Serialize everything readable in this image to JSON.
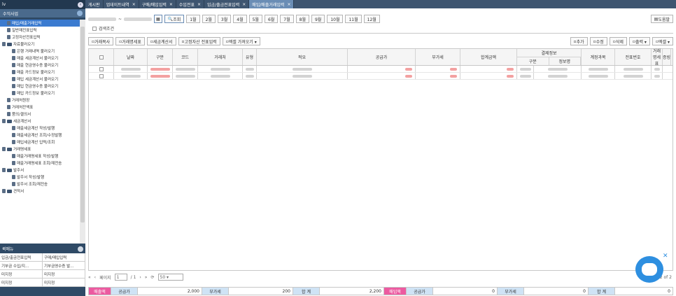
{
  "left_panel": {
    "title": "lv",
    "section": "수익사업",
    "tree": [
      {
        "label": "매입/매출거래입력",
        "level": 1,
        "type": "doc",
        "selected": true
      },
      {
        "label": "일반매전표입력",
        "level": 1,
        "type": "doc"
      },
      {
        "label": "고정자산전표입력",
        "level": 1,
        "type": "doc"
      },
      {
        "label": "자료불러오기",
        "level": 0,
        "type": "folder"
      },
      {
        "label": "은행 거래내역 불러오기",
        "level": 2,
        "type": "doc"
      },
      {
        "label": "매출 세금계산서 불러오기",
        "level": 2,
        "type": "doc"
      },
      {
        "label": "매출 현금영수증 불러오기",
        "level": 2,
        "type": "doc"
      },
      {
        "label": "매출 카드정보 불러오기",
        "level": 2,
        "type": "doc"
      },
      {
        "label": "매입 세금계산서 불러오기",
        "level": 2,
        "type": "doc"
      },
      {
        "label": "매입 현금영수증 불러오기",
        "level": 2,
        "type": "doc"
      },
      {
        "label": "매입 카드정보 불러오기",
        "level": 2,
        "type": "doc"
      },
      {
        "label": "거래처원장",
        "level": 1,
        "type": "doc"
      },
      {
        "label": "거래처잔액표",
        "level": 1,
        "type": "doc"
      },
      {
        "label": "품의/결의서",
        "level": 1,
        "type": "doc"
      },
      {
        "label": "세금계산서",
        "level": 0,
        "type": "folder"
      },
      {
        "label": "매출세금계산 작성/발행",
        "level": 2,
        "type": "doc"
      },
      {
        "label": "매출세금계산 조회/수정발행",
        "level": 2,
        "type": "doc"
      },
      {
        "label": "매입세금계산 입력/조회",
        "level": 2,
        "type": "doc"
      },
      {
        "label": "거래명세표",
        "level": 0,
        "type": "folder"
      },
      {
        "label": "매출거래명세표 작성/발행",
        "level": 2,
        "type": "doc"
      },
      {
        "label": "매출거래명세표 조회/재전송",
        "level": 2,
        "type": "doc"
      },
      {
        "label": "발주서",
        "level": 0,
        "type": "folder"
      },
      {
        "label": "발주서 작성/발행",
        "level": 2,
        "type": "doc"
      },
      {
        "label": "발주서 조회/재전송",
        "level": 2,
        "type": "doc"
      },
      {
        "label": "견적서",
        "level": 0,
        "type": "folder"
      }
    ],
    "quick_menu": {
      "title": "퀵메뉴",
      "rows": [
        [
          "입금/출금전표입력",
          "구매/매입입력"
        ],
        [
          "기부금 수입/지…",
          "기부금영수증 발…"
        ],
        [
          "미지정",
          "미지정"
        ],
        [
          "미지정",
          "미지정"
        ]
      ]
    }
  },
  "tabs": [
    {
      "label": "게시판",
      "active": false
    },
    {
      "label": "업데이트내역",
      "active": false
    },
    {
      "label": "구매/매입입력",
      "active": false
    },
    {
      "label": "수입전표",
      "active": false
    },
    {
      "label": "입금/출금전표입력",
      "active": false
    },
    {
      "label": "매입/매출거래입력",
      "active": true
    }
  ],
  "toolbar": {
    "tilde": "~",
    "search_label": "조회",
    "months": [
      "1월",
      "2월",
      "3월",
      "4월",
      "5월",
      "6월",
      "7월",
      "8월",
      "9월",
      "10월",
      "11월",
      "12월"
    ],
    "help_label": "도움말"
  },
  "search_condition": "검색조건",
  "actions": {
    "left": [
      "거래복사",
      "거래명세표",
      "세금계산서",
      "고정자산 전표입력",
      "엑셀 가져오기 ▾"
    ],
    "right": [
      "추가",
      "수정",
      "삭제",
      "출력 ▾",
      "엑셀 ▾"
    ]
  },
  "grid": {
    "headers": [
      "날짜",
      "구분",
      "코드",
      "거래처",
      "유형",
      "적요",
      "공급가",
      "부가세",
      "합계금액",
      "결제정보",
      "계정과목",
      "전표번호",
      "거래명세표",
      "증빙"
    ],
    "payment_sub": [
      "구분",
      "정보명"
    ],
    "row_count": 2
  },
  "pager": {
    "page_label": "페이지",
    "page_value": "1",
    "page_total": "/ 1",
    "page_size": "50",
    "count": "2 of 2"
  },
  "summary": {
    "sales_label": "매출액",
    "sales_supply_label": "공급가",
    "sales_supply": "2,000",
    "sales_vat_label": "부가세",
    "sales_vat": "200",
    "sales_total_label": "합 계",
    "sales_total": "2,200",
    "purchase_label": "매입액",
    "purchase_supply_label": "공급가",
    "purchase_supply": "0",
    "purchase_vat_label": "부가세",
    "purchase_vat": "0",
    "purchase_total_label": "합 계",
    "purchase_total": "0"
  }
}
